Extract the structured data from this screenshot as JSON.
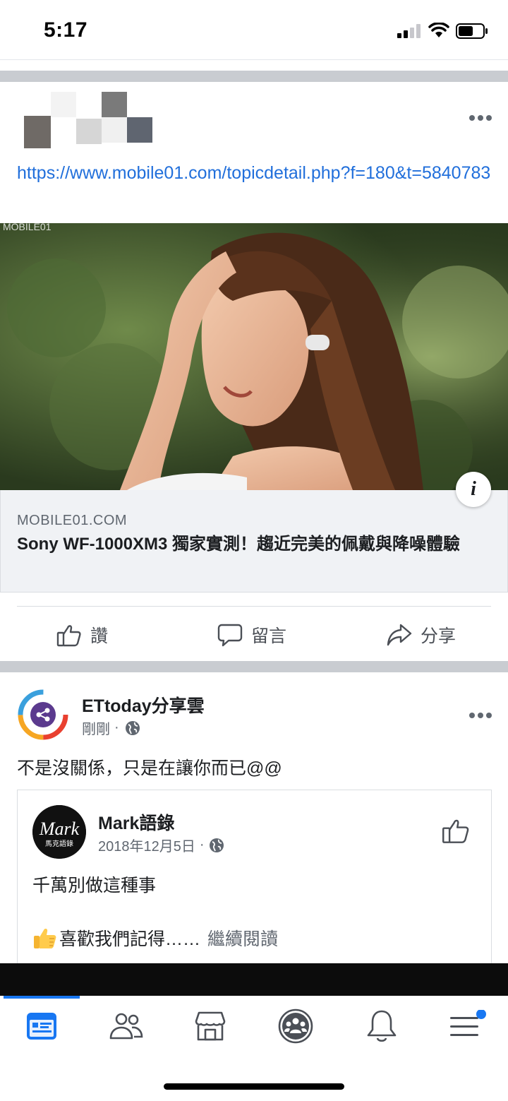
{
  "status_bar": {
    "time": "5:17"
  },
  "post1": {
    "link_url": "https://www.mobile01.com/topicdetail.php?f=180&t=5840783",
    "image_alt": "MOBILE01",
    "card": {
      "domain": "MOBILE01.COM",
      "title": "Sony WF-1000XM3 獨家實測！趨近完美的佩戴與降噪體驗"
    },
    "actions": {
      "like": "讚",
      "comment": "留言",
      "share": "分享"
    }
  },
  "post2": {
    "page_name": "ETtoday分享雲",
    "time": "剛剛",
    "privacy_icon": "globe-icon",
    "text": "不是沒關係，只是在讓你而已@@",
    "shared": {
      "page_name": "Mark語錄",
      "avatar_text": "Mark",
      "avatar_subtext": "馬克語錄",
      "date": "2018年12月5日",
      "text": "千萬別做這種事",
      "more_text": "喜歡我們記得……",
      "read_more": "繼續閱讀"
    }
  },
  "nav": {
    "items": [
      "home-icon",
      "friends-icon",
      "marketplace-icon",
      "groups-icon",
      "notifications-icon",
      "menu-icon"
    ],
    "active": 0,
    "accent": "#1877f2"
  }
}
